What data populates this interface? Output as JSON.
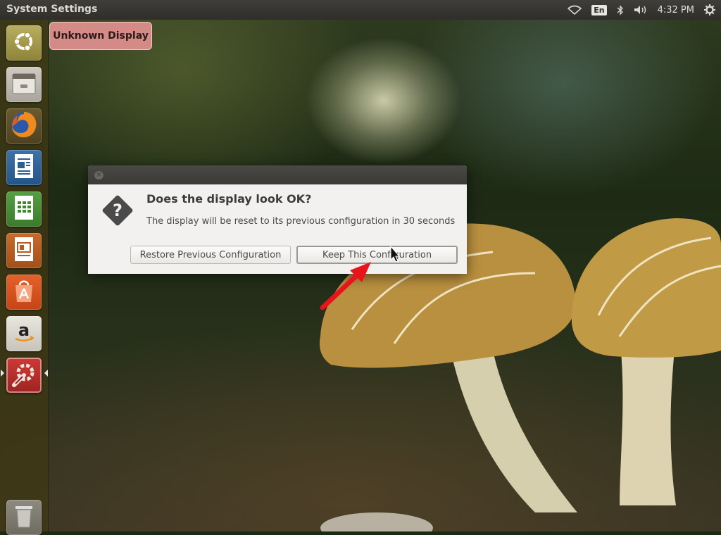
{
  "top_panel": {
    "app_title": "System Settings",
    "keyboard_layout": "En",
    "clock": "4:32 PM",
    "icons": [
      "wifi-icon",
      "keyboard-layout-indicator",
      "bluetooth-icon",
      "volume-icon",
      "gear-icon"
    ]
  },
  "launcher": {
    "items": [
      {
        "name": "ubuntu-dash",
        "icon": "ubuntu-logo-icon"
      },
      {
        "name": "files",
        "icon": "file-cabinet-icon"
      },
      {
        "name": "firefox",
        "icon": "firefox-icon"
      },
      {
        "name": "libreoffice-writer",
        "icon": "writer-document-icon"
      },
      {
        "name": "libreoffice-calc",
        "icon": "calc-spreadsheet-icon"
      },
      {
        "name": "libreoffice-impress",
        "icon": "impress-presentation-icon"
      },
      {
        "name": "ubuntu-software-center",
        "icon": "shopping-bag-icon"
      },
      {
        "name": "amazon",
        "icon": "amazon-icon"
      },
      {
        "name": "system-settings",
        "icon": "settings-wrench-icon",
        "active": true
      },
      {
        "name": "trash",
        "icon": "trash-icon"
      }
    ],
    "tooltip": "Unknown Display"
  },
  "dialog": {
    "heading": "Does the display look OK?",
    "message": "The display will be reset to its previous configuration in 30 seconds",
    "restore_button": "Restore Previous Configuration",
    "keep_button": "Keep This Configuration",
    "icon": "question-icon"
  },
  "colors": {
    "tooltip_bg": "#d48a86",
    "arrow": "#e8141c",
    "launcher_bg": "#403814"
  }
}
